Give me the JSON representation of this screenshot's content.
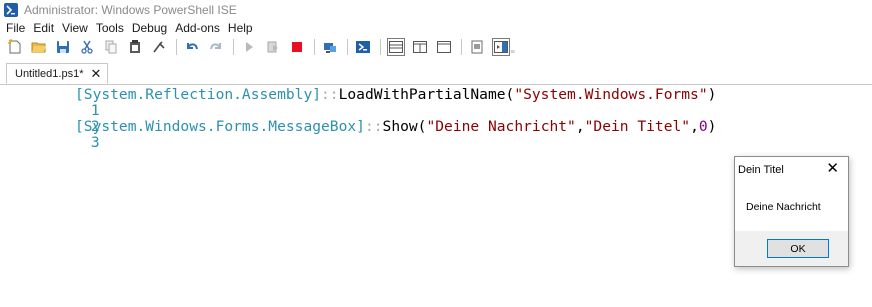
{
  "window": {
    "title": "Administrator: Windows PowerShell ISE"
  },
  "menu": {
    "items": [
      "File",
      "Edit",
      "View",
      "Tools",
      "Debug",
      "Add-ons",
      "Help"
    ]
  },
  "toolbar": {
    "icons": [
      "new-file-icon",
      "open-folder-icon",
      "save-icon",
      "cut-icon",
      "copy-icon",
      "paste-icon",
      "clear-console-icon",
      "undo-icon",
      "redo-icon",
      "run-script-icon",
      "run-selection-icon",
      "stop-icon",
      "remote-powershell-icon",
      "powershell-console-icon",
      "show-script-pane-top-icon",
      "show-script-pane-right-icon",
      "show-script-pane-maximized-icon",
      "command-window-icon",
      "show-command-addon-icon"
    ],
    "overflow": "₌"
  },
  "tabs": [
    {
      "label": "Untitled1.ps1*",
      "close": "✕"
    }
  ],
  "editor": {
    "lines": [
      {
        "number": "1",
        "type": "[System.Reflection.Assembly]",
        "op": "::",
        "method": "LoadWithPartialName(",
        "arg1": "\"System.Windows.Forms\"",
        "close": ")"
      },
      {
        "number": "2"
      },
      {
        "number": "3",
        "type": "[System.Windows.Forms.MessageBox]",
        "op": "::",
        "method": "Show(",
        "arg1": "\"Deine Nachricht\"",
        "comma1": ",",
        "arg2": "\"Dein Titel\"",
        "comma2": ",",
        "arg3": "0",
        "close": ")"
      }
    ]
  },
  "messagebox": {
    "title": "Dein Titel",
    "close": "✕",
    "message": "Deine Nachricht",
    "ok_label": "OK"
  },
  "colors": {
    "type": "#2b91af",
    "operator": "#a9a9a9",
    "string": "#8b0000",
    "number": "#800080",
    "line_number": "#2b91af",
    "stop": "#e81123",
    "accent": "#0078d7"
  }
}
